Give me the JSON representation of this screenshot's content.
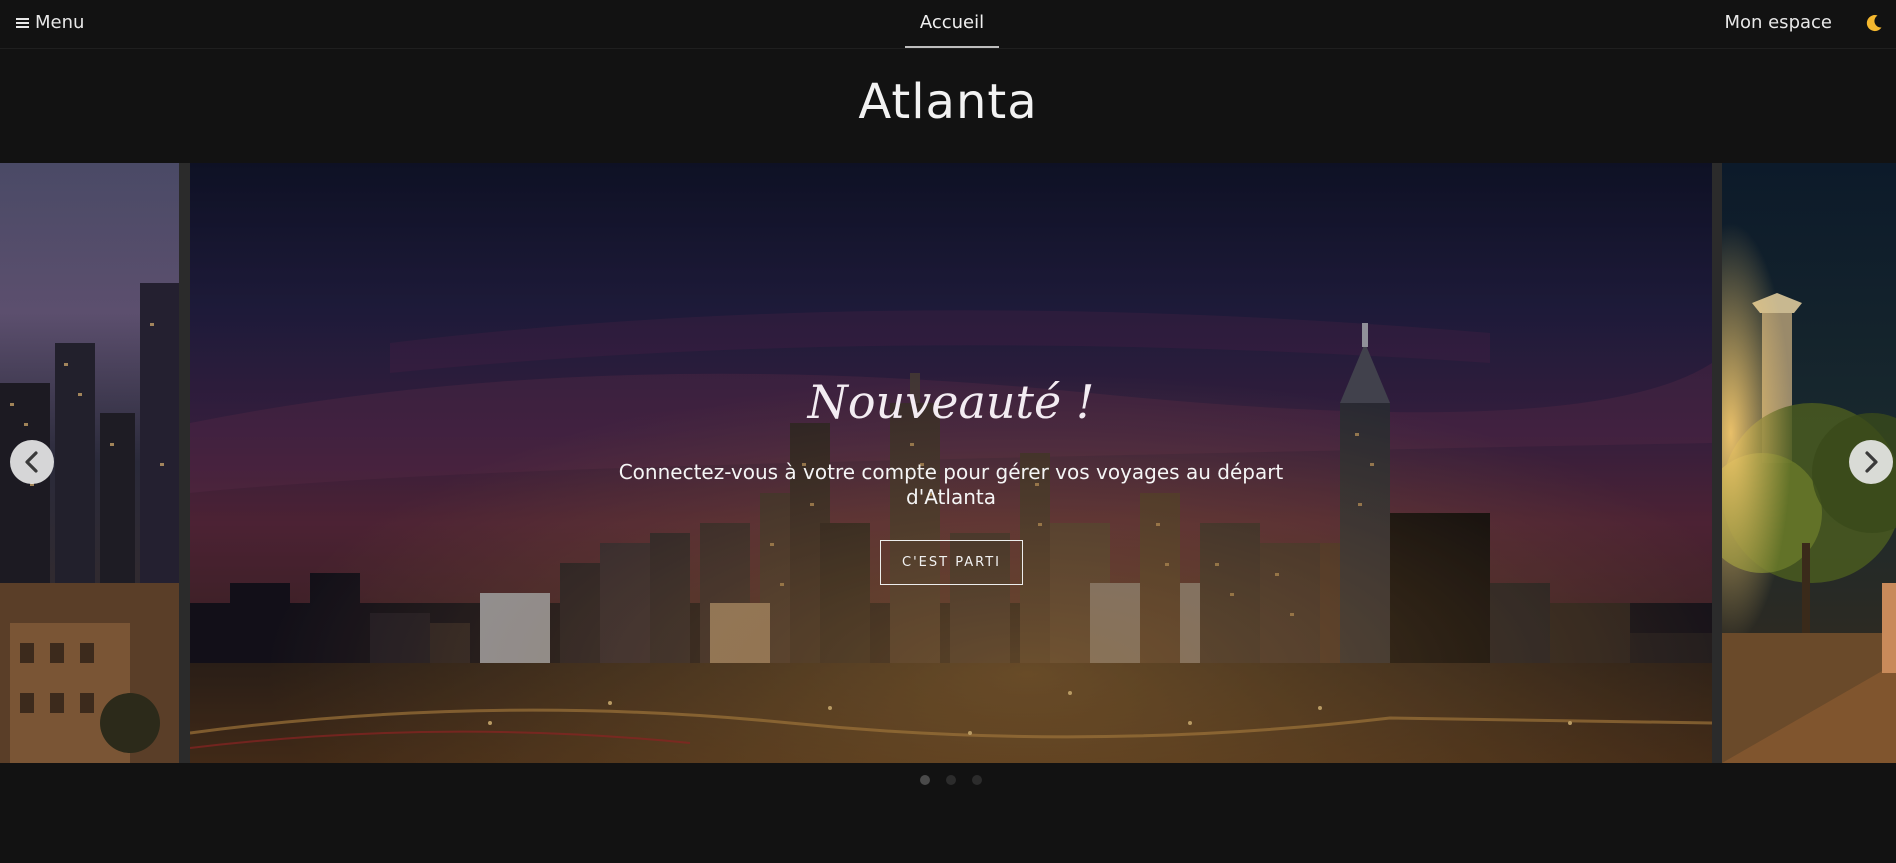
{
  "nav": {
    "menu_label": "Menu",
    "center_tab": "Accueil",
    "account_label": "Mon espace",
    "theme_icon": "moon-icon"
  },
  "page": {
    "title": "Atlanta"
  },
  "carousel": {
    "heading": "Nouveauté !",
    "text": "Connectez-vous à votre compte pour gérer vos voyages au départ d'Atlanta",
    "cta_label": "C'EST PARTI",
    "active_index": 0,
    "slide_count": 3,
    "prev_icon": "chevron-left-icon",
    "next_icon": "chevron-right-icon"
  },
  "colors": {
    "background": "#121212",
    "moon": "#f5b82e"
  }
}
